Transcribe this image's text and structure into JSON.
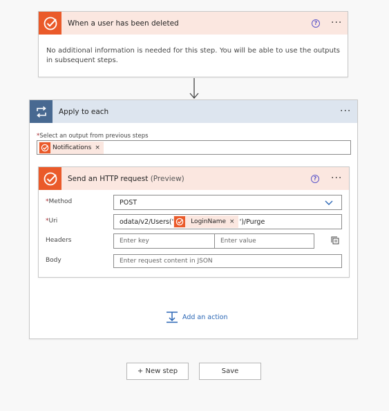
{
  "trigger": {
    "title": "When a user has been deleted",
    "help_glyph": "?",
    "menu_glyph": "···",
    "description": "No additional information is needed for this step. You will be able to use the outputs in subsequent steps."
  },
  "loop": {
    "title": "Apply to each",
    "menu_glyph": "···",
    "select_label": "Select an output from previous steps",
    "required_mark": "*",
    "token_label": "Notifications",
    "token_remove": "×"
  },
  "http_action": {
    "title": "Send an HTTP request",
    "title_suffix": "(Preview)",
    "help_glyph": "?",
    "menu_glyph": "···",
    "method_label": "Method",
    "method_value": "POST",
    "uri_label": "Uri",
    "uri_prefix": "odata/v2/Users('",
    "uri_token": "LoginName",
    "uri_token_remove": "×",
    "uri_suffix": "')/Purge",
    "headers_label": "Headers",
    "header_key_placeholder": "Enter key",
    "header_value_placeholder": "Enter value",
    "body_label": "Body",
    "body_placeholder": "Enter request content in JSON"
  },
  "add_action_label": "Add an action",
  "footer": {
    "new_step_label": "+ New step",
    "save_label": "Save"
  },
  "colors": {
    "accent_orange": "#ea5a2a",
    "header_peach": "#fbe7e0",
    "loop_blue": "#486991",
    "loop_header": "#dde5ef",
    "link_blue": "#2a66b5"
  }
}
